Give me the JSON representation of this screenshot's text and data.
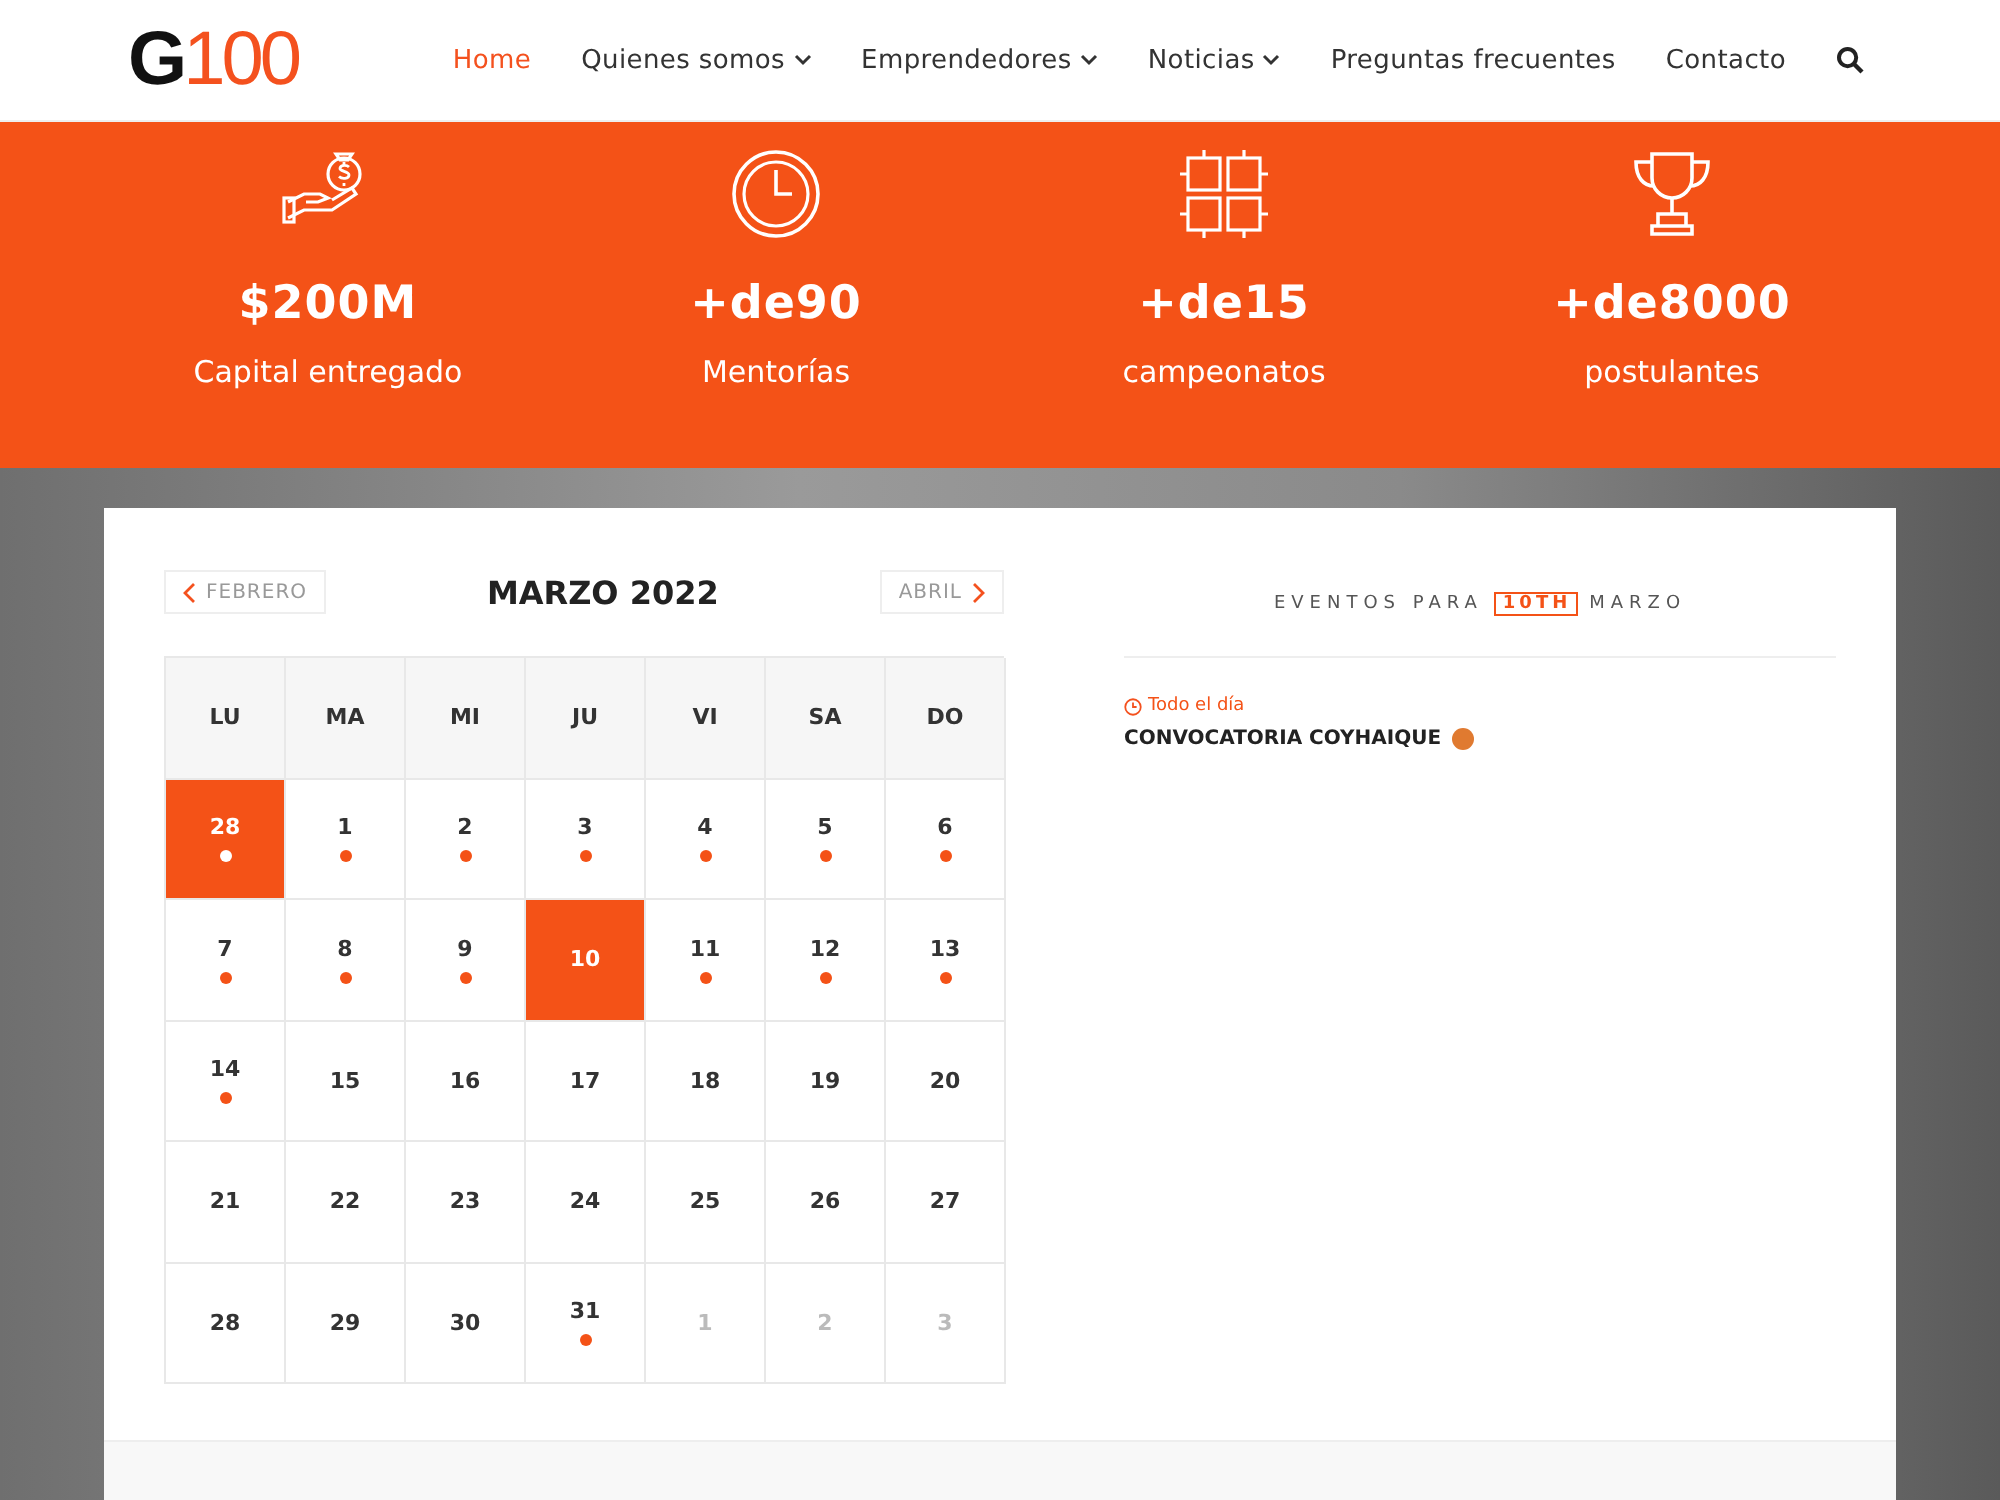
{
  "logo": {
    "letter": "G",
    "number": "100"
  },
  "nav": [
    {
      "label": "Home",
      "selected": true,
      "dropdown": false
    },
    {
      "label": "Quienes somos",
      "selected": false,
      "dropdown": true
    },
    {
      "label": "Emprendedores",
      "selected": false,
      "dropdown": true
    },
    {
      "label": "Noticias",
      "selected": false,
      "dropdown": true
    },
    {
      "label": "Preguntas frecuentes",
      "selected": false,
      "dropdown": false
    },
    {
      "label": "Contacto",
      "selected": false,
      "dropdown": false
    }
  ],
  "stats": [
    {
      "kind": "money",
      "value": "$200M",
      "label": "Capital entregado"
    },
    {
      "kind": "clock",
      "value": "+de90",
      "label": "Mentorías"
    },
    {
      "kind": "hands",
      "value": "+de15",
      "label": "campeonatos"
    },
    {
      "kind": "trophy",
      "value": "+de8000",
      "label": "postulantes"
    }
  ],
  "calendar": {
    "prev": "FEBRERO",
    "title": "MARZO 2022",
    "next": "ABRIL",
    "weekdays": [
      "LU",
      "MA",
      "MI",
      "JU",
      "VI",
      "SA",
      "DO"
    ],
    "days": [
      {
        "day": "28",
        "selected": true,
        "today": false,
        "has_event": true,
        "other_month": false
      },
      {
        "day": "1",
        "selected": false,
        "today": false,
        "has_event": true,
        "other_month": false
      },
      {
        "day": "2",
        "selected": false,
        "today": false,
        "has_event": true,
        "other_month": false
      },
      {
        "day": "3",
        "selected": false,
        "today": false,
        "has_event": true,
        "other_month": false
      },
      {
        "day": "4",
        "selected": false,
        "today": false,
        "has_event": true,
        "other_month": false
      },
      {
        "day": "5",
        "selected": false,
        "today": false,
        "has_event": true,
        "other_month": false
      },
      {
        "day": "6",
        "selected": false,
        "today": false,
        "has_event": true,
        "other_month": false
      },
      {
        "day": "7",
        "selected": false,
        "today": false,
        "has_event": true,
        "other_month": false
      },
      {
        "day": "8",
        "selected": false,
        "today": false,
        "has_event": true,
        "other_month": false
      },
      {
        "day": "9",
        "selected": false,
        "today": false,
        "has_event": true,
        "other_month": false
      },
      {
        "day": "10",
        "selected": true,
        "today": false,
        "has_event": false,
        "other_month": false
      },
      {
        "day": "11",
        "selected": false,
        "today": false,
        "has_event": true,
        "other_month": false
      },
      {
        "day": "12",
        "selected": false,
        "today": false,
        "has_event": true,
        "other_month": false
      },
      {
        "day": "13",
        "selected": false,
        "today": false,
        "has_event": true,
        "other_month": false
      },
      {
        "day": "14",
        "selected": false,
        "today": false,
        "has_event": true,
        "other_month": false
      },
      {
        "day": "15",
        "selected": false,
        "today": false,
        "has_event": false,
        "other_month": false
      },
      {
        "day": "16",
        "selected": false,
        "today": false,
        "has_event": false,
        "other_month": false
      },
      {
        "day": "17",
        "selected": false,
        "today": false,
        "has_event": false,
        "other_month": false
      },
      {
        "day": "18",
        "selected": false,
        "today": false,
        "has_event": false,
        "other_month": false
      },
      {
        "day": "19",
        "selected": false,
        "today": false,
        "has_event": false,
        "other_month": false
      },
      {
        "day": "20",
        "selected": false,
        "today": false,
        "has_event": false,
        "other_month": false
      },
      {
        "day": "21",
        "selected": false,
        "today": false,
        "has_event": false,
        "other_month": false
      },
      {
        "day": "22",
        "selected": false,
        "today": false,
        "has_event": false,
        "other_month": false
      },
      {
        "day": "23",
        "selected": false,
        "today": false,
        "has_event": false,
        "other_month": false
      },
      {
        "day": "24",
        "selected": false,
        "today": false,
        "has_event": false,
        "other_month": false
      },
      {
        "day": "25",
        "selected": false,
        "today": false,
        "has_event": false,
        "other_month": false
      },
      {
        "day": "26",
        "selected": false,
        "today": false,
        "has_event": false,
        "other_month": false
      },
      {
        "day": "27",
        "selected": false,
        "today": false,
        "has_event": false,
        "other_month": false
      },
      {
        "day": "28",
        "selected": false,
        "today": false,
        "has_event": false,
        "other_month": false
      },
      {
        "day": "29",
        "selected": false,
        "today": false,
        "has_event": false,
        "other_month": false
      },
      {
        "day": "30",
        "selected": false,
        "today": false,
        "has_event": false,
        "other_month": false
      },
      {
        "day": "31",
        "selected": false,
        "today": false,
        "has_event": true,
        "other_month": false
      },
      {
        "day": "1",
        "selected": false,
        "today": false,
        "has_event": false,
        "other_month": true
      },
      {
        "day": "2",
        "selected": false,
        "today": false,
        "has_event": false,
        "other_month": true
      },
      {
        "day": "3",
        "selected": false,
        "today": false,
        "has_event": false,
        "other_month": true
      }
    ]
  },
  "events": {
    "heading_before": "EVENTOS PARA",
    "heading_date": "10TH",
    "heading_after": "MARZO",
    "items": [
      {
        "time": "Todo el día",
        "title": "CONVOCATORIA COYHAIQUE",
        "color": "#e07a30"
      }
    ]
  }
}
